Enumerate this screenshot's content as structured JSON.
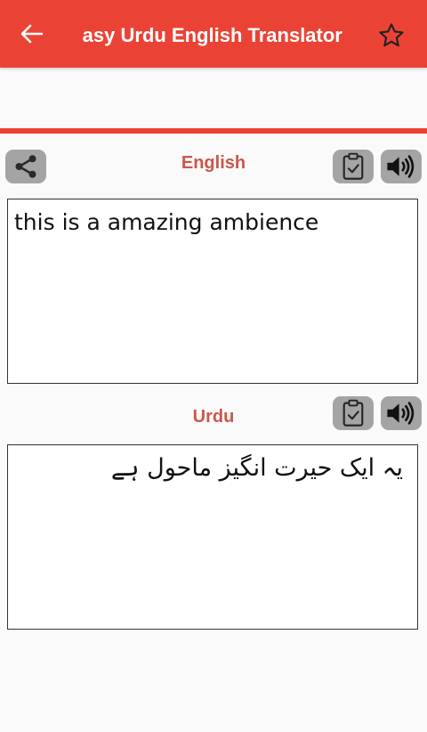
{
  "app_bar": {
    "title": "Easy Urdu English Translator",
    "background": "#ea4335"
  },
  "source": {
    "language_label": "English",
    "input_text": "this is a amazing ambience",
    "buttons": {
      "share_icon": "share-icon",
      "clipboard_icon": "clipboard-check-icon",
      "speak_icon": "speaker-icon"
    }
  },
  "target": {
    "language_label": "Urdu",
    "output_text": "یہ ایک حیرت انگیز ماحول ہے",
    "buttons": {
      "clipboard_icon": "clipboard-check-icon",
      "speak_icon": "speaker-icon"
    }
  },
  "colors": {
    "accent": "#ea4335",
    "label": "#c9584b",
    "button_bg": "#a4a4a4"
  }
}
